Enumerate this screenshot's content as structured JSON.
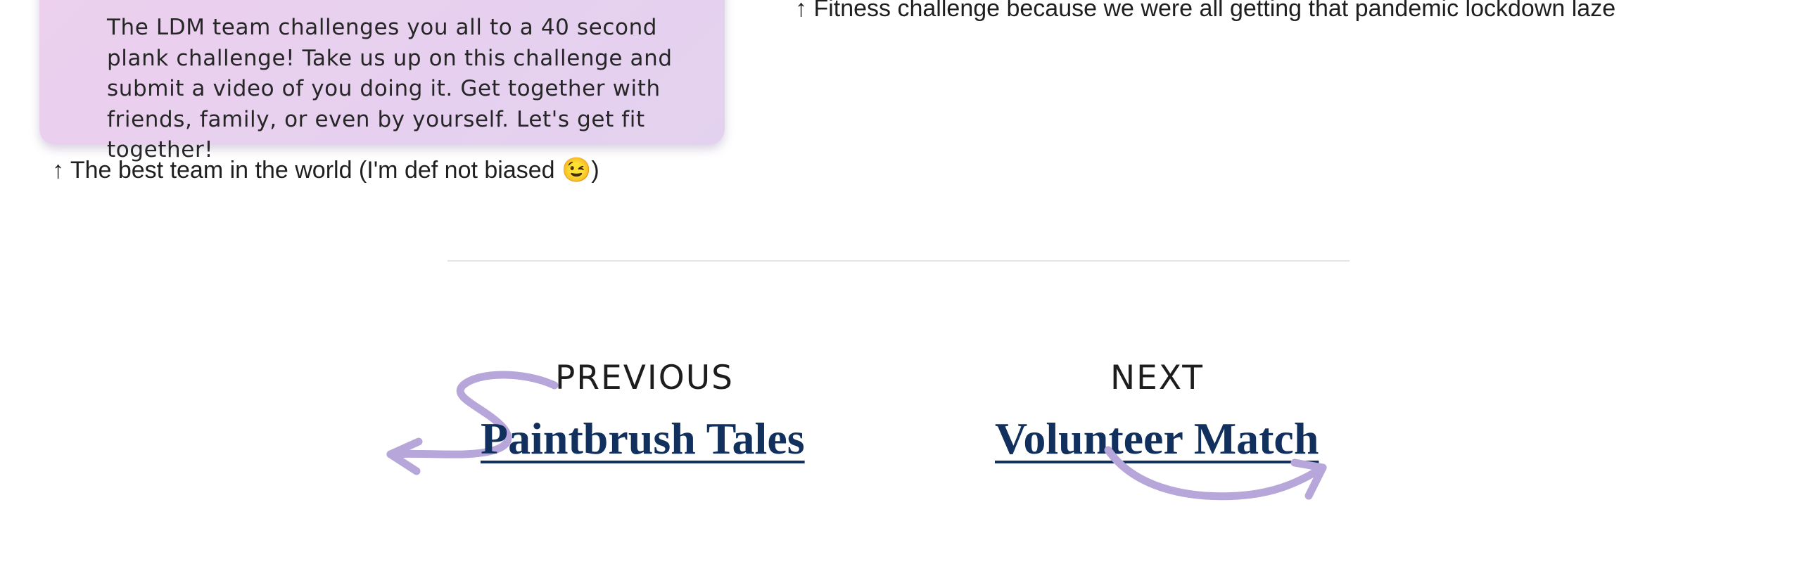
{
  "challenge_card": {
    "text": "The LDM team challenges you all to a 40 second plank challenge! Take us up on this challenge and submit a video of you doing it. Get together with friends, family, or even by yourself. Let's get fit together!"
  },
  "captions": {
    "left": "↑ The best team in the world (I'm def not biased 😉)",
    "right": "↑ Fitness challenge because we were all getting that pandemic lockdown laze"
  },
  "post_navigation": {
    "previous": {
      "label": "PREVIOUS",
      "title": "Paintbrush Tales",
      "arrow_icon": "curly-arrow-left-icon"
    },
    "next": {
      "label": "NEXT",
      "title": "Volunteer Match",
      "arrow_icon": "swoosh-arrow-right-icon"
    },
    "accent_color": "#b7a6da",
    "link_color": "#12305e"
  }
}
